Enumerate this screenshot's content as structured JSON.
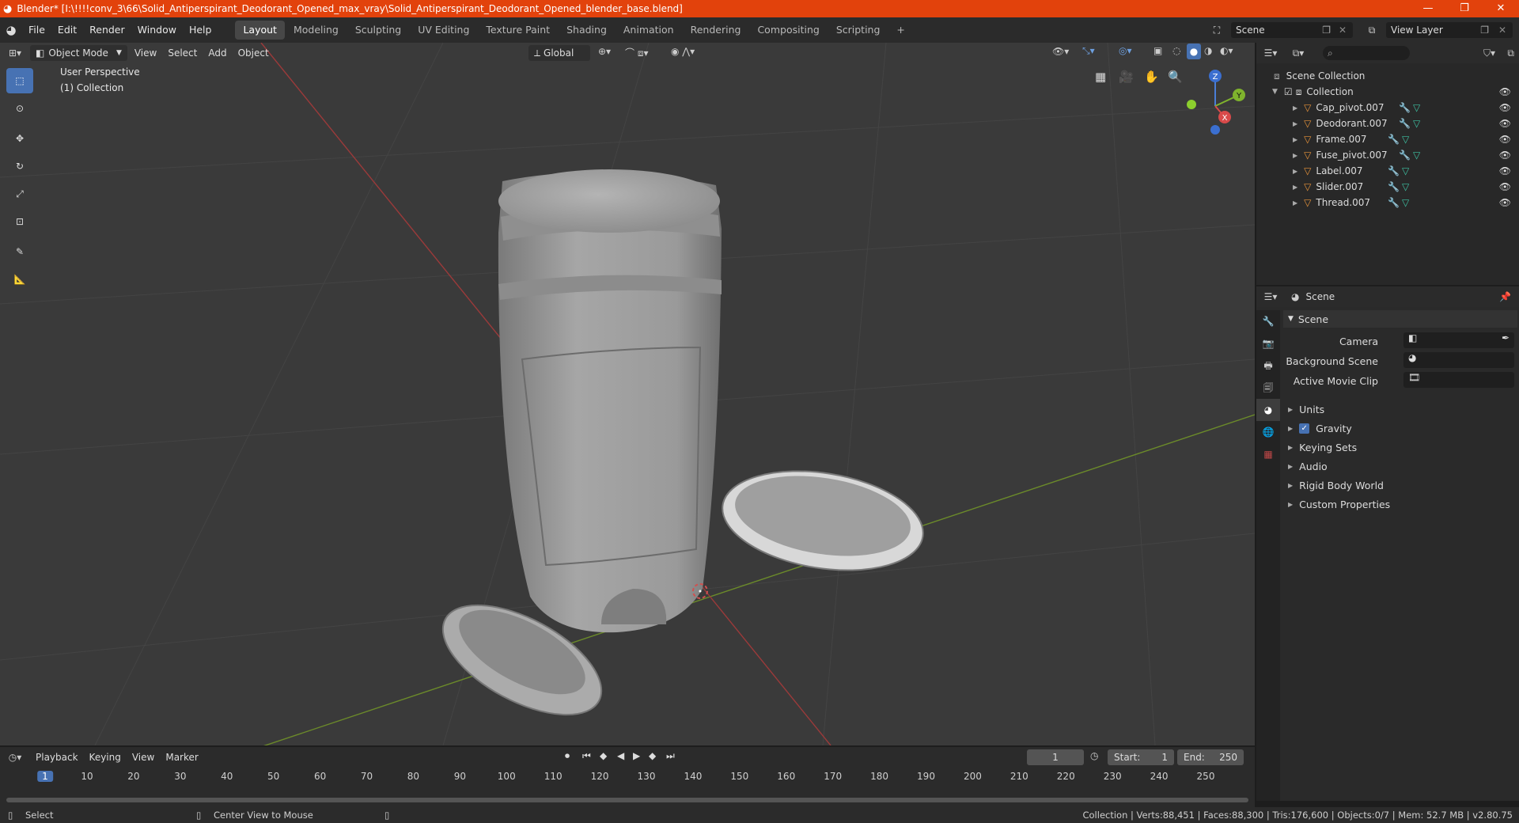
{
  "window": {
    "title": "Blender* [I:\\!!!!conv_3\\66\\Solid_Antiperspirant_Deodorant_Opened_max_vray\\Solid_Antiperspirant_Deodorant_Opened_blender_base.blend]",
    "minimize": "—",
    "maximize": "❐",
    "close": "✕"
  },
  "topbar": {
    "menus": [
      "File",
      "Edit",
      "Render",
      "Window",
      "Help"
    ],
    "workspaces": [
      "Layout",
      "Modeling",
      "Sculpting",
      "UV Editing",
      "Texture Paint",
      "Shading",
      "Animation",
      "Rendering",
      "Compositing",
      "Scripting"
    ],
    "active_workspace": "Layout",
    "add_tab": "+",
    "scene": "Scene",
    "view_layer": "View Layer"
  },
  "viewport": {
    "mode": "Object Mode",
    "menus": [
      "View",
      "Select",
      "Add",
      "Object"
    ],
    "transform_orientation": "Global",
    "overlay_title": "User Perspective",
    "overlay_collection": "(1) Collection",
    "gizmo_axes": {
      "z": "Z",
      "y": "Y",
      "x": "X"
    }
  },
  "outliner": {
    "root": "Scene Collection",
    "collection": "Collection",
    "items": [
      "Cap_pivot.007",
      "Deodorant.007",
      "Frame.007",
      "Fuse_pivot.007",
      "Label.007",
      "Slider.007",
      "Thread.007"
    ]
  },
  "properties": {
    "context": "Scene",
    "panel": "Scene",
    "fields": {
      "camera": "Camera",
      "background_scene": "Background Scene",
      "active_movie_clip": "Active Movie Clip"
    },
    "sections": [
      "Units",
      "Gravity",
      "Keying Sets",
      "Audio",
      "Rigid Body World",
      "Custom Properties"
    ],
    "gravity_enabled": true
  },
  "timeline": {
    "menus": [
      "Playback",
      "Keying",
      "View",
      "Marker"
    ],
    "current_frame": "1",
    "start_label": "Start:",
    "start": "1",
    "end_label": "End:",
    "end": "250",
    "ticks": [
      "1",
      "10",
      "20",
      "30",
      "40",
      "50",
      "60",
      "70",
      "80",
      "90",
      "100",
      "110",
      "120",
      "130",
      "140",
      "150",
      "160",
      "170",
      "180",
      "190",
      "200",
      "210",
      "220",
      "230",
      "240",
      "250"
    ]
  },
  "statusbar": {
    "left_action": "Select",
    "mid_action": "Center View to Mouse",
    "stats": "Collection | Verts:88,451 | Faces:88,300 | Tris:176,600 | Objects:0/7 | Mem: 52.7 MB | v2.80.75"
  },
  "colors": {
    "accent": "#4772b3",
    "titlebar": "#e2420c",
    "object_icon": "#e8943a",
    "modifier_icon": "#6ea0e0",
    "mesh_icon": "#3ec1a3"
  }
}
